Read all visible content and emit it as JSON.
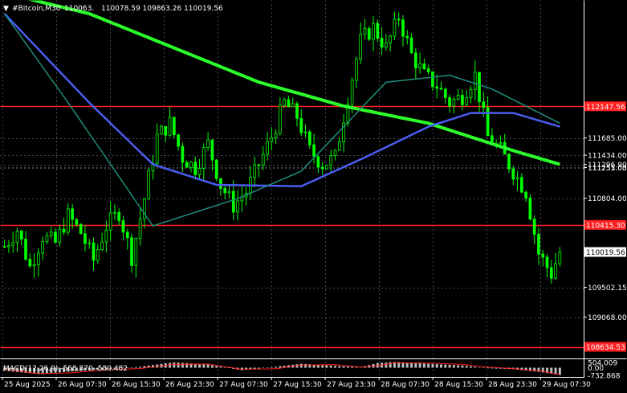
{
  "header": {
    "arrow": "▼",
    "symbol": "#Bitcoin,M30",
    "ohlc": "110063.",
    "ohlc_rest": "110078.59 109863.26 110019.56"
  },
  "macd_header": "MACD(12,26,9) -568.870 -580.482",
  "colors": {
    "background": "#000000",
    "candle": "#00ff00",
    "grid": "#444a55",
    "ma_fast": "#1e8c7a",
    "ma_mid": "#4a5df0",
    "ma_slow": "#2bff2b",
    "hline": "#ff2020",
    "macd_hist": "#c0c0c0",
    "macd_signal": "#ff2020",
    "price_tag_bg": "#ffffff"
  },
  "price_axis": {
    "ticks": [
      "111434.00",
      "111296.90",
      "111255.05",
      "111213.05",
      "111685.00",
      "111251.00",
      "110804.00",
      "110415.30",
      "110019.56",
      "109502.15",
      "109068.00",
      "108634.53"
    ]
  },
  "price_axis_labels": [
    {
      "text": "111434.00",
      "price": 111434.0,
      "kind": "tick"
    },
    {
      "text": "111296.90",
      "price": 111296.9,
      "kind": "tick"
    },
    {
      "text": "111255.05",
      "price": 111255.05,
      "kind": "tick"
    },
    {
      "text": "112147.56",
      "price": 112147.56,
      "kind": "hline"
    },
    {
      "text": "111685.00",
      "price": 111685.0,
      "kind": "tick"
    },
    {
      "text": "111251.00",
      "price": 111251.0,
      "kind": "tick"
    },
    {
      "text": "110804.00",
      "price": 110804.0,
      "kind": "tick"
    },
    {
      "text": "110415.30",
      "price": 110415.3,
      "kind": "hline"
    },
    {
      "text": "110019.56",
      "price": 110019.56,
      "kind": "current"
    },
    {
      "text": "109502.15",
      "price": 109502.15,
      "kind": "tick"
    },
    {
      "text": "109068.00",
      "price": 109068.0,
      "kind": "tick"
    },
    {
      "text": "108634.53",
      "price": 108634.53,
      "kind": "hline"
    }
  ],
  "macd_axis": [
    "504.009",
    "0.00",
    "-732.868"
  ],
  "time_axis": [
    "25 Aug 2025",
    "26 Aug 07:30",
    "26 Aug 15:30",
    "26 Aug 23:30",
    "27 Aug 07:30",
    "27 Aug 15:30",
    "27 Aug 23:30",
    "28 Aug 07:30",
    "28 Aug 15:30",
    "28 Aug 23:30",
    "29 Aug 07:30"
  ],
  "chart_data": {
    "type": "candlestick",
    "symbol": "#Bitcoin",
    "timeframe": "M30",
    "last_price": 110019.56,
    "horizontal_lines": [
      112147.56,
      110415.3,
      108634.53
    ],
    "price_range": [
      108500,
      113700
    ],
    "close_path": [
      [
        0,
        110100
      ],
      [
        3,
        110350
      ],
      [
        6,
        109800
      ],
      [
        9,
        110250
      ],
      [
        12,
        110150
      ],
      [
        15,
        110550
      ],
      [
        18,
        110300
      ],
      [
        21,
        109900
      ],
      [
        24,
        110400
      ],
      [
        27,
        110600
      ],
      [
        30,
        109950
      ],
      [
        33,
        110800
      ],
      [
        36,
        111700
      ],
      [
        39,
        111900
      ],
      [
        42,
        111400
      ],
      [
        45,
        111250
      ],
      [
        48,
        111600
      ],
      [
        51,
        111000
      ],
      [
        54,
        110700
      ],
      [
        57,
        110900
      ],
      [
        60,
        111300
      ],
      [
        63,
        111700
      ],
      [
        66,
        112200
      ],
      [
        69,
        112000
      ],
      [
        72,
        111500
      ],
      [
        75,
        111300
      ],
      [
        78,
        111400
      ],
      [
        81,
        112300
      ],
      [
        84,
        113100
      ],
      [
        87,
        113300
      ],
      [
        90,
        113000
      ],
      [
        93,
        113450
      ],
      [
        96,
        112900
      ],
      [
        99,
        112600
      ],
      [
        102,
        112450
      ],
      [
        105,
        112200
      ],
      [
        108,
        112300
      ],
      [
        111,
        112600
      ],
      [
        114,
        111700
      ],
      [
        117,
        111500
      ],
      [
        120,
        111200
      ],
      [
        123,
        110900
      ],
      [
        126,
        110000
      ],
      [
        129,
        109700
      ],
      [
        131,
        110019.56
      ]
    ],
    "bars": 132,
    "moving_averages": [
      {
        "color": "#2bff2b",
        "path": [
          [
            0,
            113800
          ],
          [
            20,
            113500
          ],
          [
            40,
            113000
          ],
          [
            60,
            112500
          ],
          [
            80,
            112150
          ],
          [
            100,
            111900
          ],
          [
            120,
            111500
          ],
          [
            131,
            111300
          ]
        ]
      },
      {
        "color": "#4a5df0",
        "path": [
          [
            0,
            113500
          ],
          [
            20,
            112200
          ],
          [
            35,
            111300
          ],
          [
            50,
            111000
          ],
          [
            70,
            110980
          ],
          [
            85,
            111400
          ],
          [
            100,
            111850
          ],
          [
            110,
            112050
          ],
          [
            120,
            112050
          ],
          [
            131,
            111850
          ]
        ]
      },
      {
        "color": "#1e8c7a",
        "path": [
          [
            0,
            113500
          ],
          [
            15,
            112200
          ],
          [
            35,
            110400
          ],
          [
            55,
            110800
          ],
          [
            70,
            111200
          ],
          [
            90,
            112500
          ],
          [
            105,
            112600
          ],
          [
            115,
            112400
          ],
          [
            131,
            111900
          ]
        ]
      }
    ],
    "macd": {
      "fast": 12,
      "slow": 26,
      "signal": 9,
      "main": -568.87,
      "signal_value": -580.482,
      "axis_top": 504.009,
      "axis_bottom": -732.868,
      "hist_path": [
        [
          0,
          -300
        ],
        [
          8,
          -620
        ],
        [
          16,
          -350
        ],
        [
          24,
          -150
        ],
        [
          32,
          100
        ],
        [
          40,
          520
        ],
        [
          48,
          300
        ],
        [
          56,
          -250
        ],
        [
          64,
          100
        ],
        [
          70,
          380
        ],
        [
          78,
          180
        ],
        [
          84,
          50
        ],
        [
          88,
          450
        ],
        [
          92,
          560
        ],
        [
          100,
          380
        ],
        [
          108,
          220
        ],
        [
          114,
          -50
        ],
        [
          120,
          -150
        ],
        [
          126,
          -400
        ],
        [
          131,
          -700
        ]
      ],
      "signal_path": [
        [
          0,
          -150
        ],
        [
          8,
          -580
        ],
        [
          16,
          -480
        ],
        [
          24,
          -200
        ],
        [
          32,
          -80
        ],
        [
          40,
          330
        ],
        [
          48,
          350
        ],
        [
          56,
          -150
        ],
        [
          64,
          -100
        ],
        [
          70,
          250
        ],
        [
          78,
          300
        ],
        [
          84,
          50
        ],
        [
          88,
          200
        ],
        [
          92,
          480
        ],
        [
          100,
          450
        ],
        [
          108,
          330
        ],
        [
          114,
          50
        ],
        [
          120,
          -80
        ],
        [
          126,
          -300
        ],
        [
          131,
          -650
        ]
      ]
    }
  }
}
